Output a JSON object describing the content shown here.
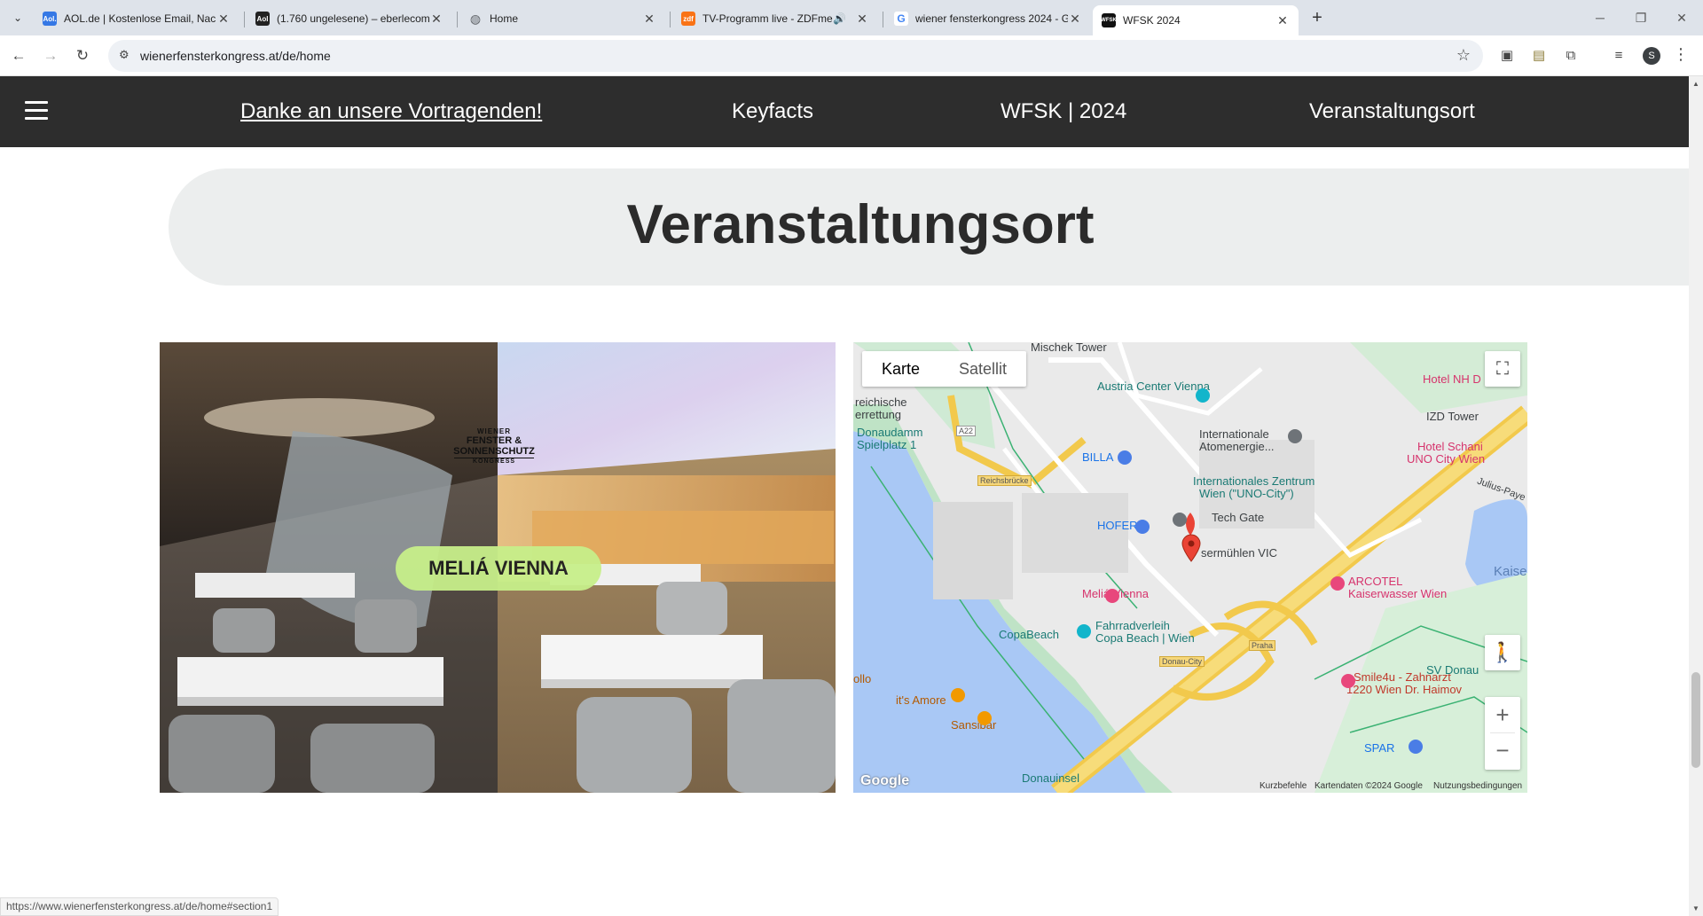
{
  "browser": {
    "tabs": [
      {
        "title": "AOL.de | Kostenlose Email, Nachr",
        "favicon": "Aol.",
        "fav_color": "#3578e5"
      },
      {
        "title": "(1.760 ungelesene) – eberlecom",
        "favicon": "Aol",
        "fav_color": "#222222"
      },
      {
        "title": "Home",
        "favicon": "globe-icon",
        "fav_color": "#5f6368"
      },
      {
        "title": "TV-Programm live - ZDFme",
        "favicon": "zdf",
        "fav_color": "#f97316"
      },
      {
        "title": "wiener fensterkongress 2024 - G",
        "favicon": "G",
        "fav_color": "#4285f4"
      },
      {
        "title": "WFSK 2024",
        "favicon": "WFSK",
        "fav_color": "#111111"
      }
    ],
    "active_tab_index": 5,
    "url": "wienerfensterkongress.at/de/home",
    "avatar_letter": "S",
    "status_url": "https://www.wienerfensterkongress.at/de/home#section1"
  },
  "site_nav": {
    "links": [
      {
        "label": "Danke an unsere Vortragenden!"
      },
      {
        "label": "Keyfacts"
      },
      {
        "label": "WFSK | 2024"
      },
      {
        "label": "Veranstaltungsort"
      }
    ]
  },
  "section": {
    "heading": "Veranstaltungsort"
  },
  "venue_photo": {
    "logo_top": "WIENER",
    "logo_main_1": "FENSTER &",
    "logo_main_2": "SONNENSCHUTZ",
    "logo_bottom": "KONGRESS",
    "badge": "MELIÁ VIENNA",
    "badge_color": "#c7ef8a"
  },
  "map": {
    "type_options": [
      "Karte",
      "Satellit"
    ],
    "selected_type": "Karte",
    "labels": {
      "mischek": "Mischek Tower",
      "austria_center": "Austria Center Vienna",
      "hotel_nh": "Hotel NH D",
      "reichische": "reichische",
      "rettung": "errettung",
      "izd": "IZD Tower",
      "donaudamm": "Donaudamm",
      "spielplatz": "Spielplatz 1",
      "a22": "A22",
      "iaea_1": "Internationale",
      "iaea_2": "Atomenergie...",
      "hotel_schani_1": "Hotel Schani",
      "hotel_schani_2": "UNO City Wien",
      "billa": "BILLA",
      "reichsbruecke": "Reichsbrücke",
      "vic_1": "Internationales Zentrum",
      "vic_2": "Wien (\"UNO-City\")",
      "julius": "Julius-Paye",
      "tech_gate": "Tech Gate",
      "hofer": "HOFER",
      "kaisermuehlen": "sermühlen VIC",
      "kaiser": "Kaise",
      "arcotel_1": "ARCOTEL",
      "arcotel_2": "Kaiserwasser Wien",
      "melia": "Meliá Vienna",
      "fahrrad_1": "Fahrradverleih",
      "fahrrad_2": "Copa Beach | Wien",
      "copabeach": "CopaBeach",
      "donau_city": "Donau-City",
      "praha": "Praha",
      "smile_1": "Smile4u - Zahnarzt",
      "smile_2": "1220 Wien Dr. Haimov",
      "sv_donau": "SV Donau",
      "ollo": "ollo",
      "its_amore": "it's Amore",
      "sansibar": "Sansibar",
      "spar": "SPAR",
      "donauinsel": "Donauinsel"
    },
    "footer": {
      "shortcuts": "Kurzbefehle",
      "mapdata": "Kartendaten ©2024 Google",
      "terms": "Nutzungsbedingungen"
    },
    "google_logo": "Google"
  }
}
